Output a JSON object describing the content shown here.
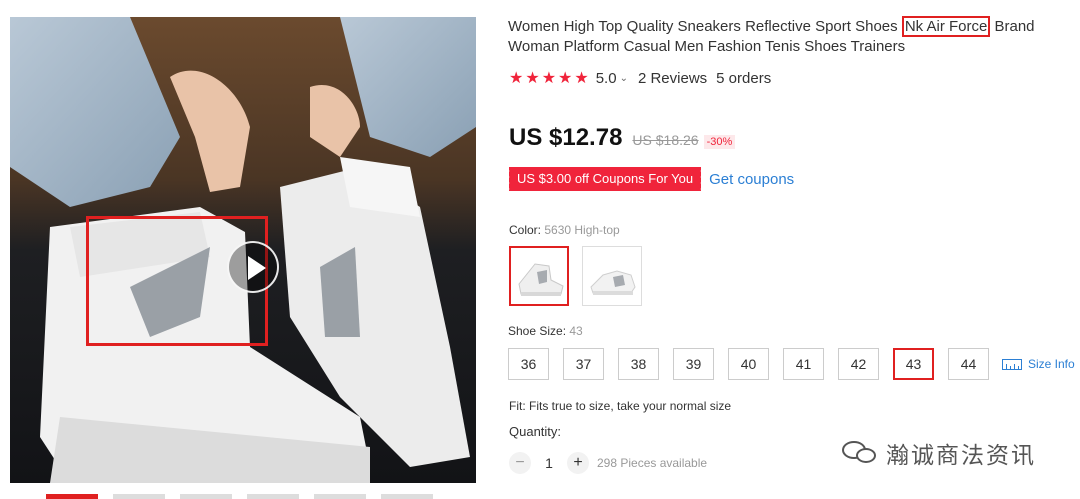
{
  "product": {
    "title_part1": "Women High Top Quality Sneakers Reflective Sport Shoes ",
    "title_highlight": "Nk Air Force",
    "title_part2": " Brand Woman Platform Casual Men Fashion Tenis Shoes Trainers",
    "rating": "5.0",
    "reviews": "2 Reviews",
    "orders": "5 orders",
    "price": "US $12.78",
    "old_price": "US $18.26",
    "discount": "-30%",
    "coupon": "US $3.00 off Coupons For You",
    "get_coupons": "Get coupons"
  },
  "color": {
    "label": "Color: ",
    "value": "5630 High-top"
  },
  "size": {
    "label": "Shoe Size: ",
    "value": "43",
    "options": [
      "36",
      "37",
      "38",
      "39",
      "40",
      "41",
      "42",
      "43",
      "44"
    ],
    "selected": "43",
    "size_info": "Size Info"
  },
  "fit": "Fit: Fits true to size, take your normal size",
  "quantity": {
    "label": "Quantity:",
    "value": "1",
    "minus": "−",
    "plus": "+",
    "available": "298 Pieces available"
  },
  "watermark": "瀚诚商法资讯",
  "icons": {
    "play": "play-icon",
    "star": "star-icon",
    "ruler": "ruler-icon",
    "wechat": "wechat-icon"
  },
  "colors": {
    "accent_red": "#f0243b",
    "highlight_red": "#e02020",
    "link_blue": "#2b7fd4"
  }
}
